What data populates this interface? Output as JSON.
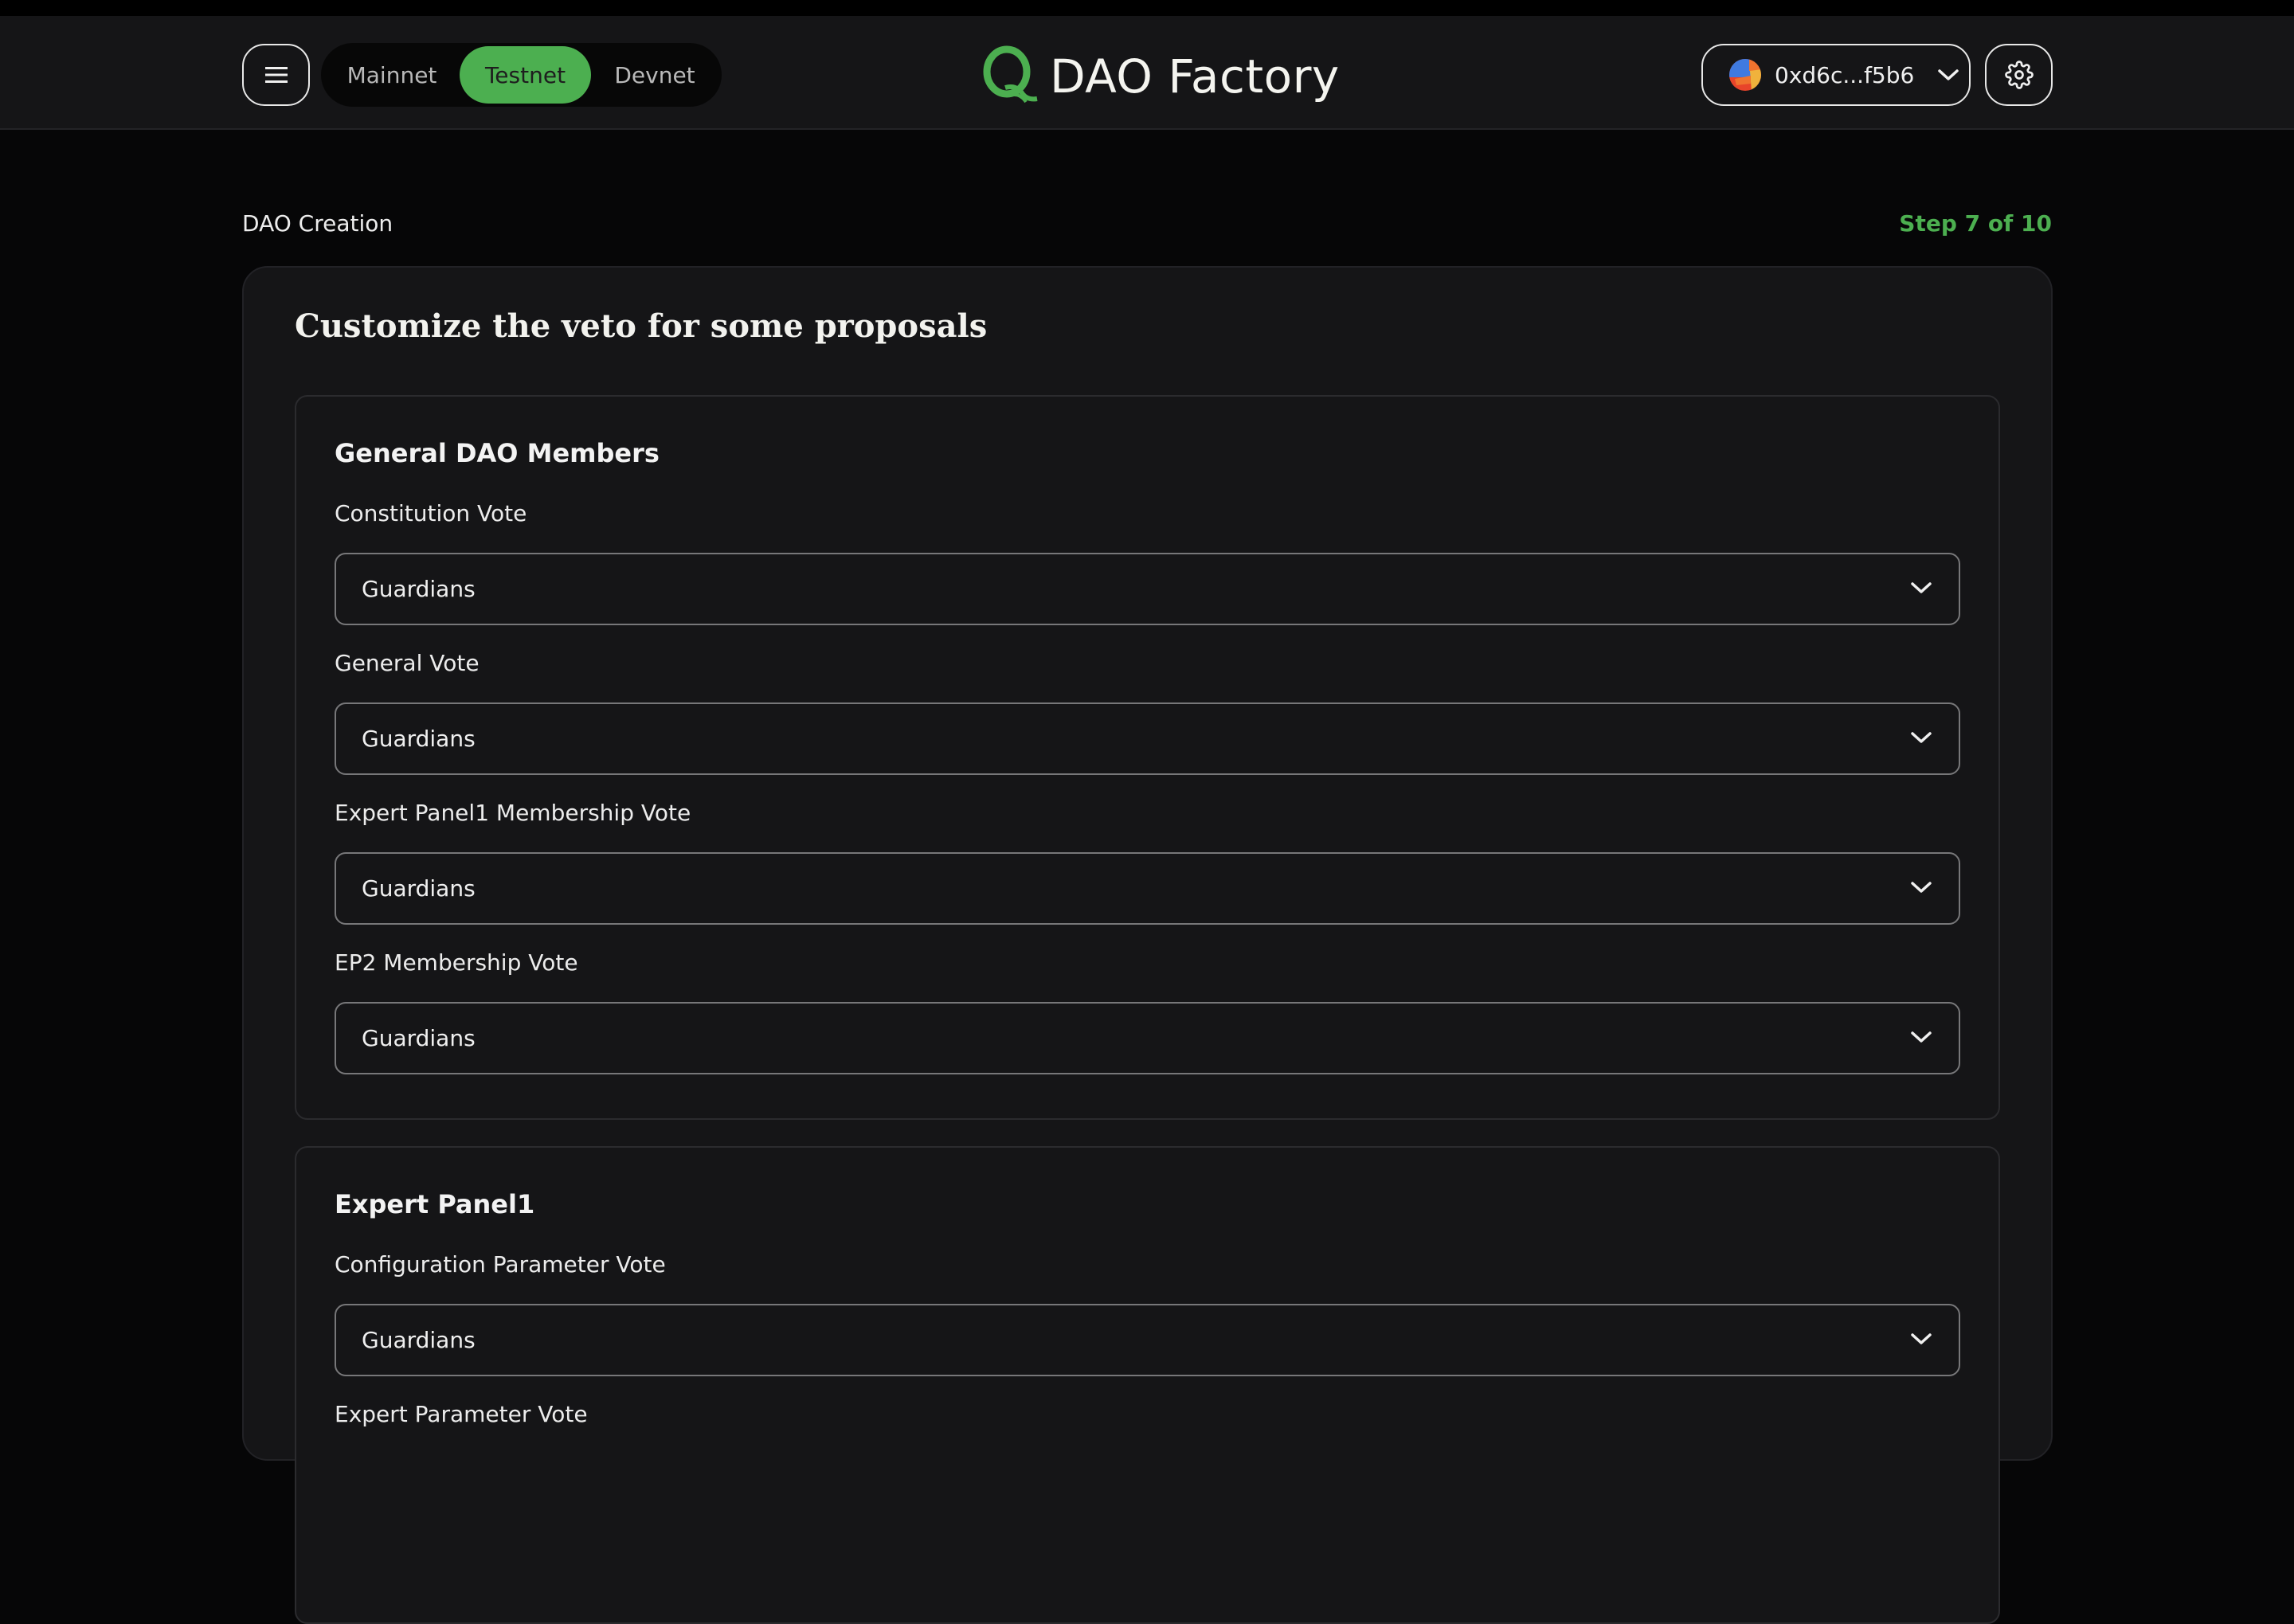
{
  "header": {
    "menu_icon": "hamburger-menu-icon",
    "networks": [
      {
        "label": "Mainnet",
        "active": false
      },
      {
        "label": "Testnet",
        "active": true
      },
      {
        "label": "Devnet",
        "active": false
      }
    ],
    "brand": {
      "logo": "Q",
      "title": "DAO Factory"
    },
    "wallet": {
      "address": "0xd6c...f5b6",
      "avatar_icon": "wallet-avatar-icon",
      "chevron_icon": "chevron-down-icon"
    },
    "settings_icon": "gear-icon"
  },
  "page": {
    "breadcrumb": "DAO Creation",
    "step": "Step 7 of 10",
    "title": "Customize the veto for some proposals"
  },
  "groups": [
    {
      "title": "General DAO Members",
      "fields": [
        {
          "label": "Constitution Vote",
          "value": "Guardians"
        },
        {
          "label": "General Vote",
          "value": "Guardians"
        },
        {
          "label": "Expert Panel1 Membership Vote",
          "value": "Guardians"
        },
        {
          "label": "EP2 Membership Vote",
          "value": "Guardians"
        }
      ]
    },
    {
      "title": "Expert Panel1",
      "fields": [
        {
          "label": "Configuration Parameter Vote",
          "value": "Guardians"
        },
        {
          "label": "Expert Parameter Vote",
          "value": ""
        }
      ]
    }
  ],
  "colors": {
    "accent": "#4caf50",
    "background": "#060607",
    "header_bg": "#151517",
    "card_bg": "#151517",
    "select_border": "#777779"
  }
}
